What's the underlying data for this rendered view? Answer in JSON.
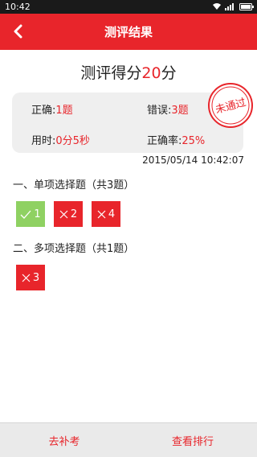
{
  "status_bar": {
    "time": "10:42",
    "icons": [
      "wifi-icon",
      "signal-icon",
      "battery-icon"
    ]
  },
  "header": {
    "title": "测评结果",
    "back_icon": "chevron-left-icon"
  },
  "score": {
    "prefix": "测评得分",
    "value": "20",
    "suffix": "分"
  },
  "summary": {
    "correct_label": "正确:",
    "correct_value": "1题",
    "wrong_label": "错误:",
    "wrong_value": "3题",
    "time_label": "用时:",
    "time_value": "0分5秒",
    "rate_label": "正确率:",
    "rate_value": "25%",
    "stamp_text": "未通过"
  },
  "date": "2015/05/14 10:42:07",
  "sections": [
    {
      "title": "一、单项选择题（共3题）",
      "questions": [
        {
          "label": "1",
          "status": "correct",
          "icon": "check-icon"
        },
        {
          "label": "2",
          "status": "wrong",
          "icon": "cross-icon"
        },
        {
          "label": "4",
          "status": "wrong",
          "icon": "cross-icon"
        }
      ]
    },
    {
      "title": "二、多项选择题（共1题）",
      "questions": [
        {
          "label": "3",
          "status": "wrong",
          "icon": "cross-icon"
        }
      ]
    }
  ],
  "footer": {
    "retake_label": "去补考",
    "ranking_label": "查看排行"
  },
  "colors": {
    "accent": "#e8252b",
    "correct": "#8fd162",
    "card_bg": "#efefef"
  }
}
